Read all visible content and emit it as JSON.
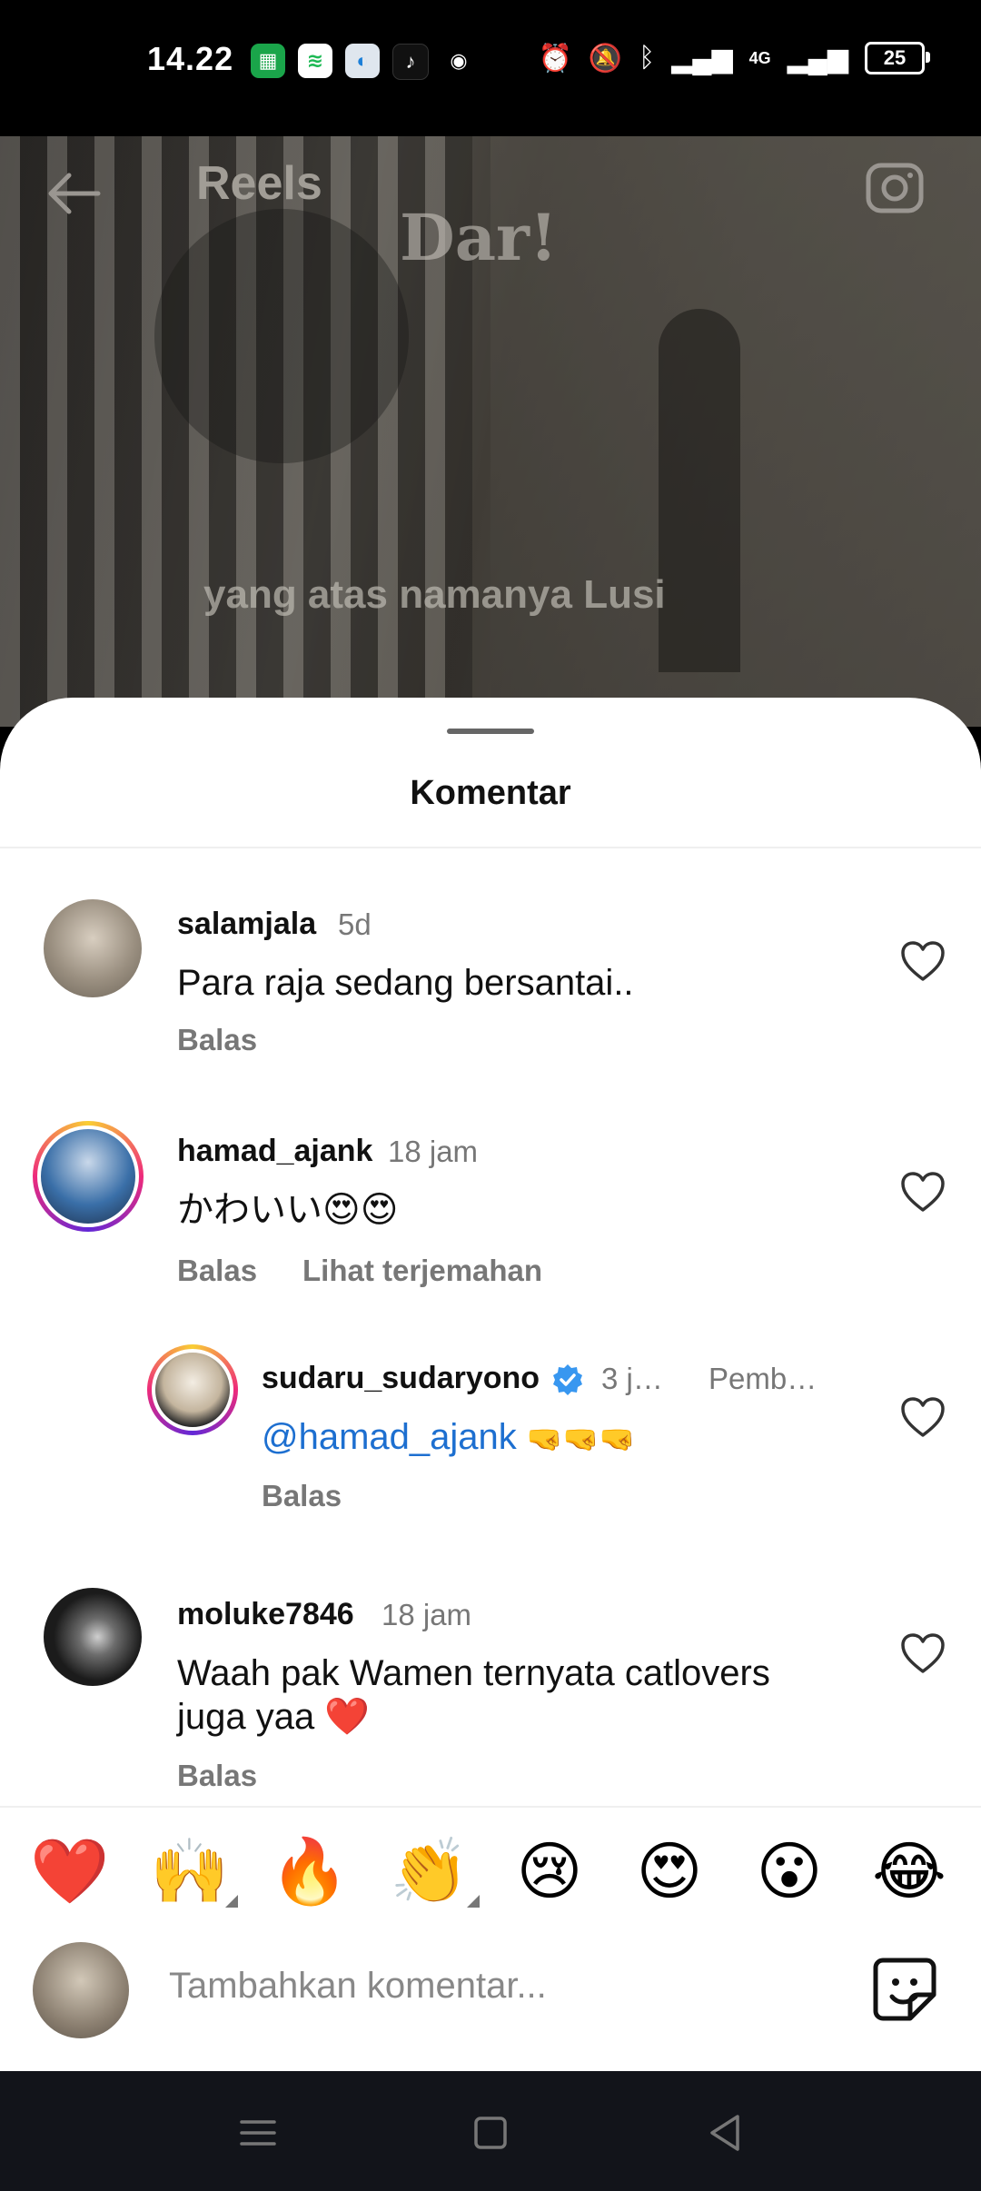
{
  "status_bar": {
    "time": "14.22",
    "battery": "25",
    "network": "4G"
  },
  "reel": {
    "title": "Reels",
    "watermark": "Dar!",
    "caption": "yang atas namanya Lusi"
  },
  "sheet": {
    "title": "Komentar"
  },
  "comments": [
    {
      "username": "salamjala",
      "time": "5d",
      "text": "Para raja sedang bersantai..",
      "reply": "Balas"
    },
    {
      "username": "hamad_ajank",
      "time": "18 jam",
      "text": "かわいい😍😍",
      "reply": "Balas",
      "translate": "Lihat terjemahan"
    },
    {
      "username": "sudaru_sudaryono",
      "time": "3 j…",
      "badge": "Pemb…",
      "mention": "@hamad_ajank",
      "text": "🤜🤜🤜",
      "reply": "Balas"
    },
    {
      "username": "moluke7846",
      "time": "18 jam",
      "text_line1": "Waah pak Wamen ternyata catlovers",
      "text_line2": "juga yaa ❤️",
      "reply": "Balas"
    }
  ],
  "emoji_bar": [
    "❤️",
    "🙌",
    "🔥",
    "👏",
    "😢",
    "😍",
    "😮",
    "😂"
  ],
  "input": {
    "placeholder": "Tambahkan komentar..."
  },
  "colors": {
    "accent_link": "#1d6fd0",
    "verified": "#3897f0"
  }
}
